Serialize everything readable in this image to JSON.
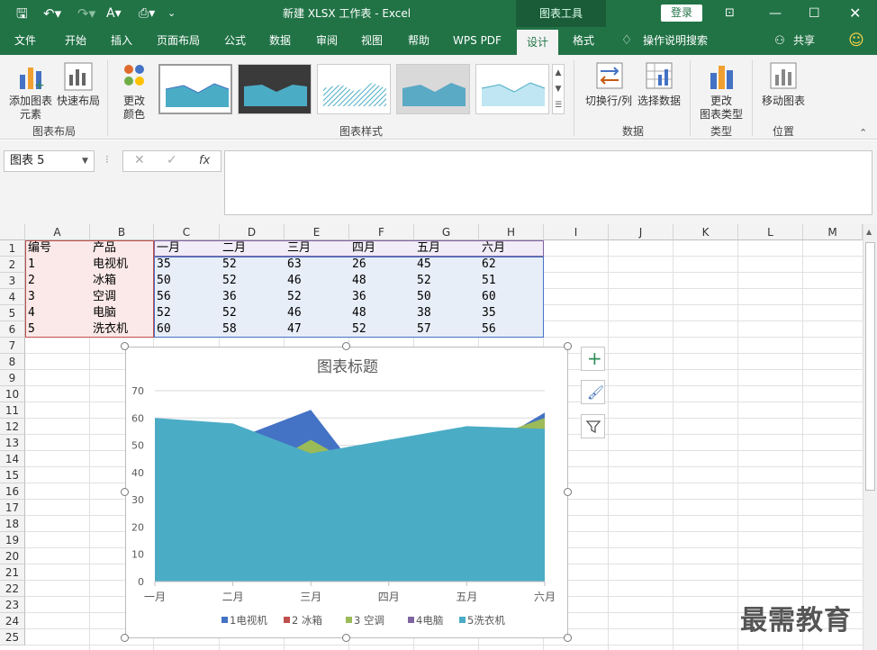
{
  "titlebar": {
    "title": "新建 XLSX 工作表  -  Excel",
    "context_tab": "图表工具",
    "login": "登录"
  },
  "menu": {
    "tabs": [
      "文件",
      "开始",
      "插入",
      "页面布局",
      "公式",
      "数据",
      "审阅",
      "视图",
      "帮助",
      "WPS PDF",
      "设计",
      "格式"
    ],
    "active": "设计",
    "tellme": "操作说明搜索",
    "share": "共享"
  },
  "ribbon": {
    "add_element": "添加图表\n元素",
    "quick_layout": "快速布局",
    "change_color": "更改\n颜色",
    "group_layout": "图表布局",
    "group_styles": "图表样式",
    "switch_rowcol": "切换行/列",
    "select_data": "选择数据",
    "group_data": "数据",
    "change_type": "更改\n图表类型",
    "group_type": "类型",
    "move_chart": "移动图表",
    "group_location": "位置"
  },
  "formula": {
    "namebox": "图表 5",
    "value": ""
  },
  "columns": [
    "A",
    "B",
    "C",
    "D",
    "E",
    "F",
    "G",
    "H",
    "I",
    "J",
    "K",
    "L",
    "M"
  ],
  "rows": [
    "1",
    "2",
    "3",
    "4",
    "5",
    "6",
    "7",
    "8",
    "9",
    "10",
    "11",
    "12",
    "13",
    "14",
    "15",
    "16",
    "17",
    "18",
    "19",
    "20",
    "21",
    "22",
    "23",
    "24",
    "25"
  ],
  "table": {
    "header": [
      "编号",
      "产品",
      "一月",
      "二月",
      "三月",
      "四月",
      "五月",
      "六月"
    ],
    "data": [
      [
        "1",
        "电视机",
        "35",
        "52",
        "63",
        "26",
        "45",
        "62"
      ],
      [
        "2",
        "冰箱",
        "50",
        "52",
        "46",
        "48",
        "52",
        "51"
      ],
      [
        "3",
        "空调",
        "56",
        "36",
        "52",
        "36",
        "50",
        "60"
      ],
      [
        "4",
        "电脑",
        "52",
        "52",
        "46",
        "48",
        "38",
        "35"
      ],
      [
        "5",
        "洗衣机",
        "60",
        "58",
        "47",
        "52",
        "57",
        "56"
      ]
    ]
  },
  "chart_data": {
    "type": "area",
    "title": "图表标题",
    "categories": [
      "一月",
      "二月",
      "三月",
      "四月",
      "五月",
      "六月"
    ],
    "ylim": [
      0,
      70
    ],
    "yticks": [
      "0",
      "10",
      "20",
      "30",
      "40",
      "50",
      "60",
      "70"
    ],
    "grid": true,
    "legend": "bottom",
    "series": [
      {
        "name": "1电视机",
        "values": [
          35,
          52,
          63,
          26,
          45,
          62
        ],
        "color": "#4472c4"
      },
      {
        "name": "2 冰箱",
        "values": [
          50,
          52,
          46,
          48,
          52,
          51
        ],
        "color": "#c0504d"
      },
      {
        "name": "3 空调",
        "values": [
          56,
          36,
          52,
          36,
          50,
          60
        ],
        "color": "#9bbb59"
      },
      {
        "name": "4电脑",
        "values": [
          52,
          52,
          46,
          48,
          38,
          35
        ],
        "color": "#8064a2"
      },
      {
        "name": "5洗衣机",
        "values": [
          60,
          58,
          47,
          52,
          57,
          56
        ],
        "color": "#4bacc6"
      }
    ]
  },
  "watermark": "最需教育"
}
